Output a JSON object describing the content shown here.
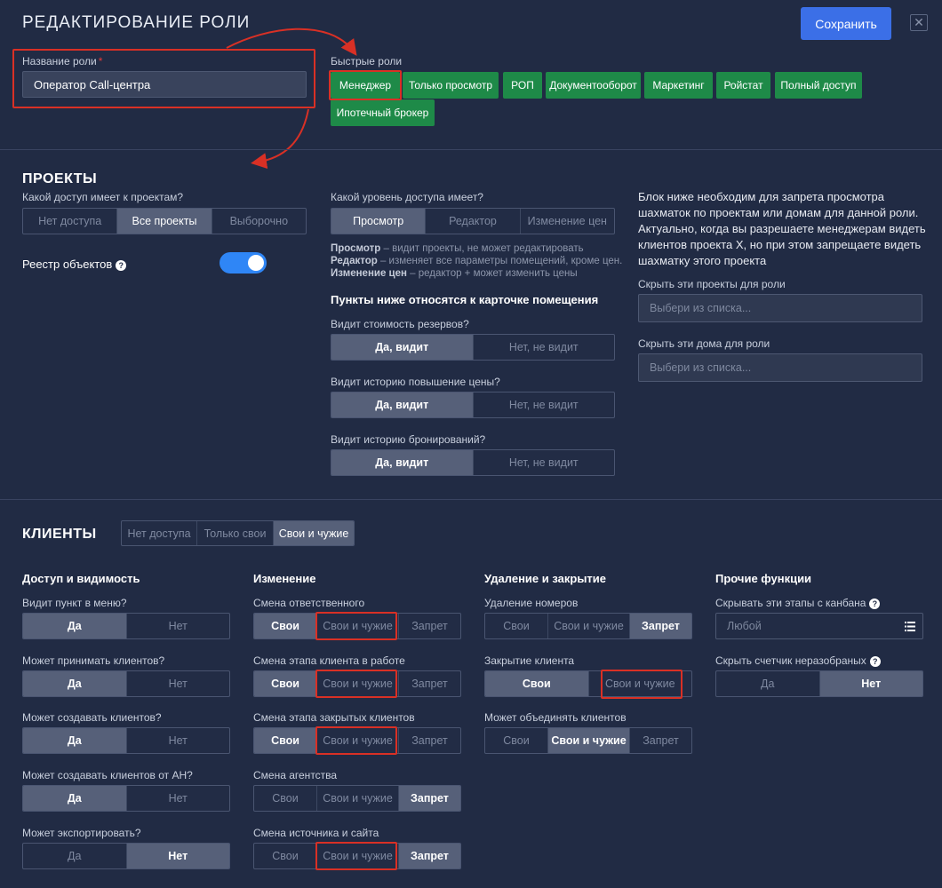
{
  "header": {
    "title": "РЕДАКТИРОВАНИЕ РОЛИ",
    "save_label": "Сохранить",
    "close_glyph": "✕"
  },
  "role_name": {
    "label": "Название роли",
    "required_mark": "*",
    "value": "Оператор Call-центра"
  },
  "quick_roles": {
    "label": "Быстрые роли",
    "items": [
      "Менеджер",
      "Только просмотр",
      "РОП",
      "Документооборот",
      "Маркетинг",
      "Ройстат",
      "Полный доступ",
      "Ипотечный брокер"
    ]
  },
  "projects": {
    "title": "ПРОЕКТЫ",
    "access_label": "Какой доступ имеет к проектам?",
    "access_options": [
      "Нет доступа",
      "Все проекты",
      "Выборочно"
    ],
    "access_selected": "Все проекты",
    "registry_label": "Реестр объектов",
    "registry_enabled": true,
    "level_label": "Какой уровень доступа имеет?",
    "level_options": [
      "Просмотр",
      "Редактор",
      "Изменение цен"
    ],
    "level_selected": "Просмотр",
    "hints": [
      {
        "term": "Просмотр",
        "text": " – видит проекты, не может редактировать"
      },
      {
        "term": "Редактор",
        "text": " – изменяет все параметры помещений, кроме цен."
      },
      {
        "term": "Изменение цен",
        "text": " – редактор + может изменить цены"
      }
    ],
    "card_title": "Пункты ниже относятся к карточке помещения",
    "card_questions": [
      {
        "label": "Видит стоимость резервов?",
        "options": [
          "Да, видит",
          "Нет, не видит"
        ],
        "selected": "Да, видит"
      },
      {
        "label": "Видит историю повышение цены?",
        "options": [
          "Да, видит",
          "Нет, не видит"
        ],
        "selected": "Да, видит"
      },
      {
        "label": "Видит историю бронирований?",
        "options": [
          "Да, видит",
          "Нет, не видит"
        ],
        "selected": "Да, видит"
      }
    ],
    "info_text": "Блок ниже необходим для запрета просмотра шахматок по проектам или домам для данной роли. Актуально, когда вы разрешаете менеджерам видеть клиентов проекта X, но при этом запрещаете видеть шахматку этого проекта",
    "hide_projects_label": "Скрыть эти проекты для роли",
    "hide_projects_placeholder": "Выбери из списка...",
    "hide_houses_label": "Скрыть эти дома для роли",
    "hide_houses_placeholder": "Выбери из списка..."
  },
  "clients": {
    "title": "КЛИЕНТЫ",
    "scope_options": [
      "Нет доступа",
      "Только свои",
      "Свои и чужие"
    ],
    "scope_selected": "Свои и чужие",
    "access_col": {
      "title": "Доступ и видимость",
      "rows": [
        {
          "label": "Видит пункт в меню?",
          "options": [
            "Да",
            "Нет"
          ],
          "selected": "Да"
        },
        {
          "label": "Может принимать клиентов?",
          "options": [
            "Да",
            "Нет"
          ],
          "selected": "Да"
        },
        {
          "label": "Может создавать клиентов?",
          "options": [
            "Да",
            "Нет"
          ],
          "selected": "Да"
        },
        {
          "label": "Может создавать клиентов от АН?",
          "options": [
            "Да",
            "Нет"
          ],
          "selected": "Да"
        },
        {
          "label": "Может экспортировать?",
          "options": [
            "Да",
            "Нет"
          ],
          "selected": "Нет"
        }
      ]
    },
    "change_col": {
      "title": "Изменение",
      "rows": [
        {
          "label": "Смена ответственного",
          "options": [
            "Свои",
            "Свои и чужие",
            "Запрет"
          ],
          "selected": "Свои"
        },
        {
          "label": "Смена этапа клиента в работе",
          "options": [
            "Свои",
            "Свои и чужие",
            "Запрет"
          ],
          "selected": "Свои"
        },
        {
          "label": "Смена этапа закрытых клиентов",
          "options": [
            "Свои",
            "Свои и чужие",
            "Запрет"
          ],
          "selected": "Свои"
        },
        {
          "label": "Смена агентства",
          "options": [
            "Свои",
            "Свои и чужие",
            "Запрет"
          ],
          "selected": "Запрет"
        },
        {
          "label": "Смена источника и сайта",
          "options": [
            "Свои",
            "Свои и чужие",
            "Запрет"
          ],
          "selected": "Запрет"
        }
      ]
    },
    "delete_col": {
      "title": "Удаление и закрытие",
      "rows": [
        {
          "label": "Удаление номеров",
          "options": [
            "Свои",
            "Свои и чужие",
            "Запрет"
          ],
          "selected": "Запрет"
        },
        {
          "label": "Закрытие клиента",
          "options": [
            "Свои",
            "Свои и чужие"
          ],
          "selected": "Свои"
        },
        {
          "label": "Может объединять клиентов",
          "options": [
            "Свои",
            "Свои и чужие",
            "Запрет"
          ],
          "selected": "Свои и чужие"
        }
      ]
    },
    "other_col": {
      "title": "Прочие функции",
      "kanban_label": "Скрывать эти этапы с канбана",
      "kanban_placeholder": "Любой",
      "counter_label": "Скрыть счетчик неразобраных",
      "counter_options": [
        "Да",
        "Нет"
      ],
      "counter_selected": "Нет"
    }
  },
  "colors": {
    "background": "#212b44",
    "accent": "#3b6fe7",
    "quick_role": "#1e8a48",
    "annotation": "#d93025",
    "toggle": "#2f86f6"
  }
}
